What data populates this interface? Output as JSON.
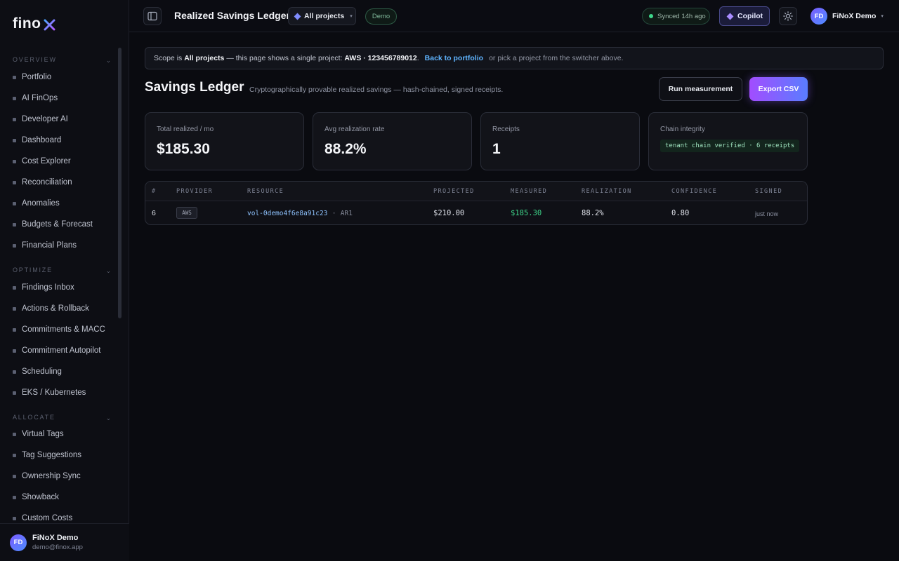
{
  "brand": {
    "logo_text": "fino"
  },
  "sidebar": {
    "sections": [
      {
        "label": "OVERVIEW",
        "items": [
          "Portfolio",
          "AI FinOps",
          "Developer AI",
          "Dashboard",
          "Cost Explorer",
          "Reconciliation",
          "Anomalies",
          "Budgets & Forecast",
          "Financial Plans"
        ]
      },
      {
        "label": "OPTIMIZE",
        "items": [
          "Findings Inbox",
          "Actions & Rollback",
          "Commitments & MACC",
          "Commitment Autopilot",
          "Scheduling",
          "EKS / Kubernetes"
        ]
      },
      {
        "label": "ALLOCATE",
        "items": [
          "Virtual Tags",
          "Tag Suggestions",
          "Ownership Sync",
          "Showback",
          "Custom Costs"
        ]
      }
    ],
    "user": {
      "initials": "FD",
      "name": "FiNoX Demo",
      "email": "demo@finox.app"
    }
  },
  "topbar": {
    "title": "Realized Savings Ledger",
    "project_switch": "All projects",
    "demo_badge": "Demo",
    "sync_status": "Synced 14h ago",
    "copilot_label": "Copilot",
    "user_initials": "FD",
    "user_name": "FiNoX Demo"
  },
  "banner": {
    "prefix": "Scope is",
    "scope": "All projects",
    "middle": "— this page shows a single project:",
    "project": "AWS · 123456789012",
    "period": ".",
    "link": "Back to portfolio",
    "suffix": "or pick a project from the switcher above."
  },
  "header": {
    "title": "Savings Ledger",
    "subtitle": "Cryptographically provable realized savings — hash-chained, signed receipts.",
    "run_button": "Run measurement",
    "export_button": "Export CSV"
  },
  "stats": [
    {
      "label": "Total realized / mo",
      "value": "$185.30"
    },
    {
      "label": "Avg realization rate",
      "value": "88.2%"
    },
    {
      "label": "Receipts",
      "value": "1"
    },
    {
      "label": "Chain integrity",
      "badge": "tenant chain verified · 6 receipts"
    }
  ],
  "table": {
    "columns": [
      "#",
      "PROVIDER",
      "RESOURCE",
      "PROJECTED",
      "MEASURED",
      "REALIZATION",
      "CONFIDENCE",
      "SIGNED"
    ],
    "rows": [
      {
        "index": "6",
        "provider": "AWS",
        "resource": "vol-0demo4f6e8a91c23",
        "resource_sep": "·",
        "resource_meta": "AR1",
        "projected": "$210.00",
        "measured": "$185.30",
        "realization": "88.2%",
        "confidence": "0.80",
        "signed": "just now"
      }
    ]
  },
  "colors": {
    "accent": "#a24dff",
    "link": "#5fb4ff",
    "positive": "#3ed58a"
  }
}
